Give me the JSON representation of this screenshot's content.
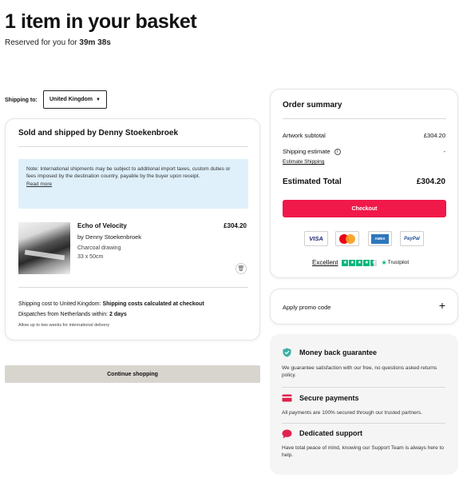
{
  "header": {
    "title": "1 item in your basket",
    "reserved_prefix": "Reserved for you for",
    "reserved_time": "39m 38s"
  },
  "shipping_selector": {
    "label": "Shipping to:",
    "value": "United Kingdom"
  },
  "seller": {
    "title": "Sold and shipped by Denny Stoekenbroek",
    "note": "Note: International shipments may be subject to additional import taxes, custom duties or fees imposed by the destination country, payable by the buyer upon receipt.",
    "note_link": "Read more",
    "item": {
      "title": "Echo of Velocity",
      "artist": "by Denny Stoekenbroek",
      "medium": "Charcoal drawing",
      "size": "33 x 50cm",
      "price": "£304.20"
    },
    "shipping_cost_label": "Shipping cost to United Kingdom:",
    "shipping_cost_value": "Shipping costs calculated at checkout",
    "dispatch_label": "Dispatches from Netherlands within:",
    "dispatch_value": "2 days",
    "intl_note": "Allow up to two weeks for international delivery"
  },
  "continue_label": "Continue shopping",
  "summary": {
    "title": "Order summary",
    "subtotal_label": "Artwork subtotal",
    "subtotal_value": "£304.20",
    "shipping_label": "Shipping estimate",
    "shipping_value": "-",
    "estimate_link": "Estimate Shipping",
    "total_label": "Estimated Total",
    "total_value": "£304.20",
    "checkout_label": "Checkout",
    "payment_methods": [
      "VISA",
      "mastercard",
      "AMEX",
      "PayPal"
    ],
    "trust_rating_label": "Excellent",
    "trust_stars": 4.5,
    "trust_brand": "Trustpilot",
    "colors": {
      "checkout": "#f0194a",
      "trustpilot": "#00b67a"
    }
  },
  "promo": {
    "label": "Apply promo code",
    "icon": "+"
  },
  "benefits": [
    {
      "icon": "shield-check-icon",
      "title": "Money back guarantee",
      "text": "We guarantee satisfaction with our free, no questions asked returns policy."
    },
    {
      "icon": "credit-card-icon",
      "title": "Secure payments",
      "text": "All payments are 100% secured through our trusted partners."
    },
    {
      "icon": "chat-bubble-icon",
      "title": "Dedicated support",
      "text": "Have total peace of mind, knowing our Support Team is always here to help."
    }
  ]
}
